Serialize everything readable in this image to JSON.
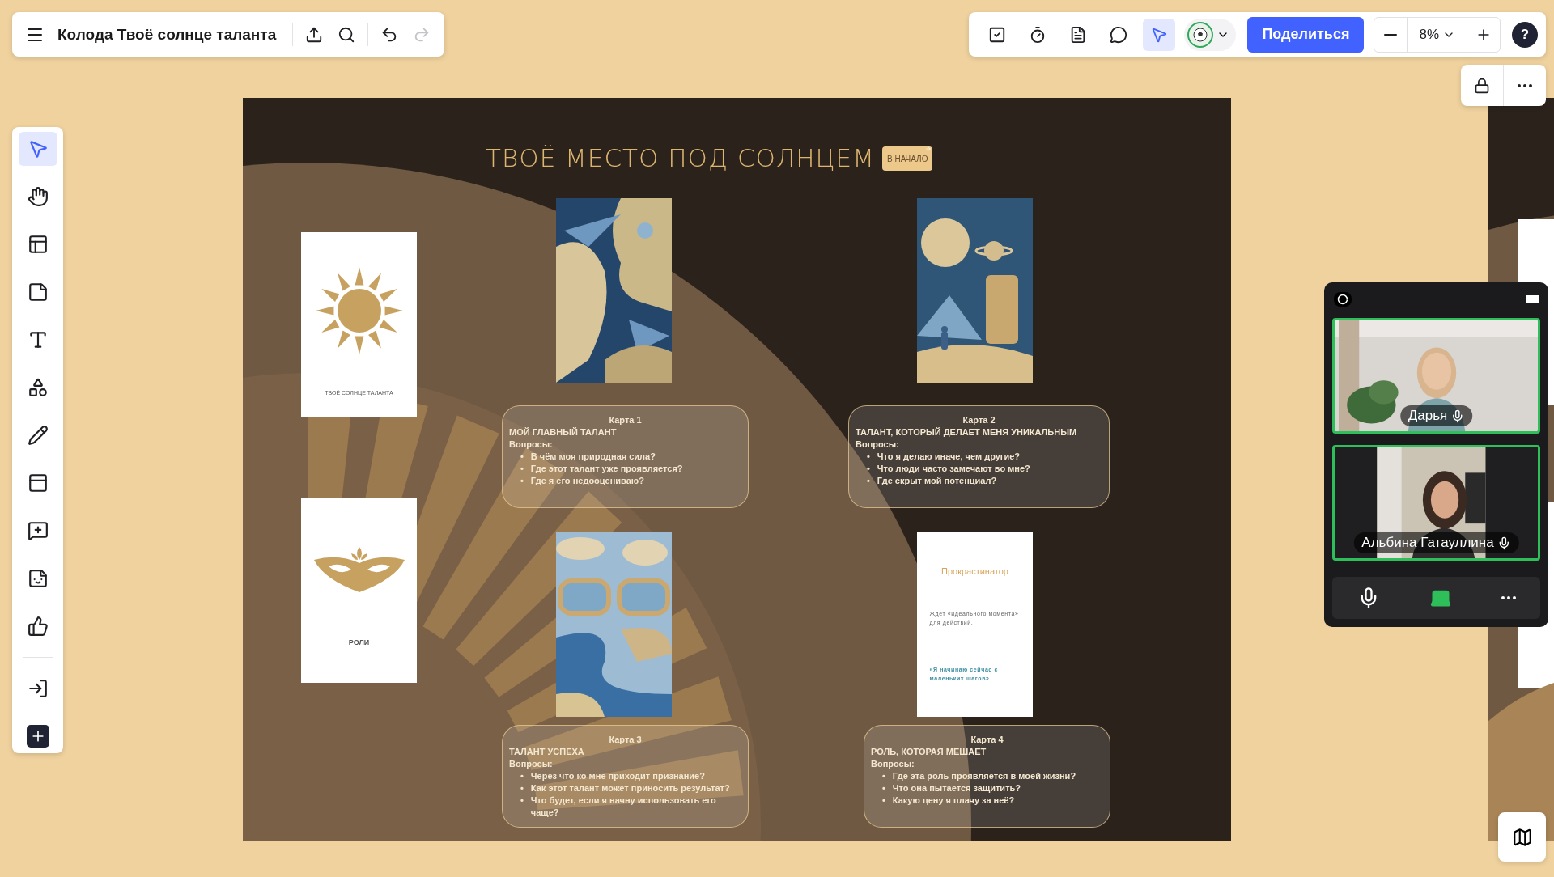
{
  "header": {
    "title": "Колода Твоё солнце таланта",
    "history": [
      {
        "kind": "undo",
        "disabled": false
      },
      {
        "kind": "redo",
        "disabled": true
      }
    ]
  },
  "collab_tools": [
    {
      "kind": "tasks",
      "selected": false
    },
    {
      "kind": "timer",
      "selected": false
    },
    {
      "kind": "notes",
      "selected": false
    },
    {
      "kind": "comments",
      "selected": false
    },
    {
      "kind": "cursors",
      "selected": true
    }
  ],
  "share_button": "Поделиться",
  "zoom": {
    "value": "8%"
  },
  "help": "?",
  "left_tools": [
    {
      "kind": "select",
      "selected": true
    },
    {
      "kind": "hand",
      "selected": false
    },
    {
      "kind": "templates",
      "selected": false
    },
    {
      "kind": "sticky",
      "selected": false
    },
    {
      "kind": "text",
      "selected": false
    },
    {
      "kind": "shapes",
      "selected": false
    },
    {
      "kind": "pen",
      "selected": false
    },
    {
      "kind": "frame",
      "selected": false
    },
    {
      "kind": "comment",
      "selected": false
    },
    {
      "kind": "sticker",
      "selected": false
    },
    {
      "kind": "reaction",
      "selected": false
    },
    {
      "kind": "import",
      "selected": false
    },
    {
      "kind": "more",
      "selected": false
    }
  ],
  "board": {
    "title": "ТВОЁ МЕСТО ПОД СОЛНЦЕМ",
    "start_button": "В НАЧАЛО",
    "deck_cards": [
      {
        "kind": "sun",
        "caption": "ТВОЁ СОЛНЦЕ ТАЛАНТА"
      },
      {
        "kind": "mask",
        "caption": "РОЛИ"
      }
    ],
    "cards": [
      {
        "kind": "picture"
      },
      {
        "kind": "picture"
      },
      {
        "kind": "picture"
      },
      {
        "kind": "role",
        "title": "Прокрастинатор",
        "description": "Ждет «идеального момента» для действий.",
        "affirmation": "«Я начинаю сейчас с маленьких шагов»"
      }
    ],
    "notes": [
      {
        "bullet": "•",
        "heading": "Карта 1",
        "title": "МОЙ ГЛАВНЫЙ ТАЛАНТ",
        "label": "Вопросы:",
        "questions": [
          "В чём моя природная сила?",
          "Где этот талант уже проявляется?",
          "Где я его недооцениваю?"
        ]
      },
      {
        "bullet": "•",
        "heading": "Карта 2",
        "title": "ТАЛАНТ, КОТОРЫЙ ДЕЛАЕТ МЕНЯ УНИКАЛЬНЫМ",
        "label": "Вопросы:",
        "questions": [
          "Что я делаю иначе, чем другие?",
          "Что люди часто замечают во мне?",
          "Где скрыт мой потенциал?"
        ]
      },
      {
        "bullet": "•",
        "heading": "Карта 3",
        "title": "ТАЛАНТ УСПЕХА",
        "label": "Вопросы:",
        "questions": [
          "Через что ко мне приходит признание?",
          "Как этот талант может приносить результат?",
          "Что будет, если я начну использовать его чаще?"
        ]
      },
      {
        "bullet": "•",
        "heading": "Карта 4",
        "title": "РОЛЬ, КОТОРАЯ МЕШАЕТ",
        "label": "Вопросы:",
        "questions": [
          "Где эта роль проявляется в моей жизни?",
          "Что она пытается защитить?",
          "Какую цену я плачу за неё?"
        ]
      }
    ]
  },
  "call": {
    "participants": [
      {
        "name": "Дарья"
      },
      {
        "name": "Альбина Гатауллина"
      }
    ]
  }
}
